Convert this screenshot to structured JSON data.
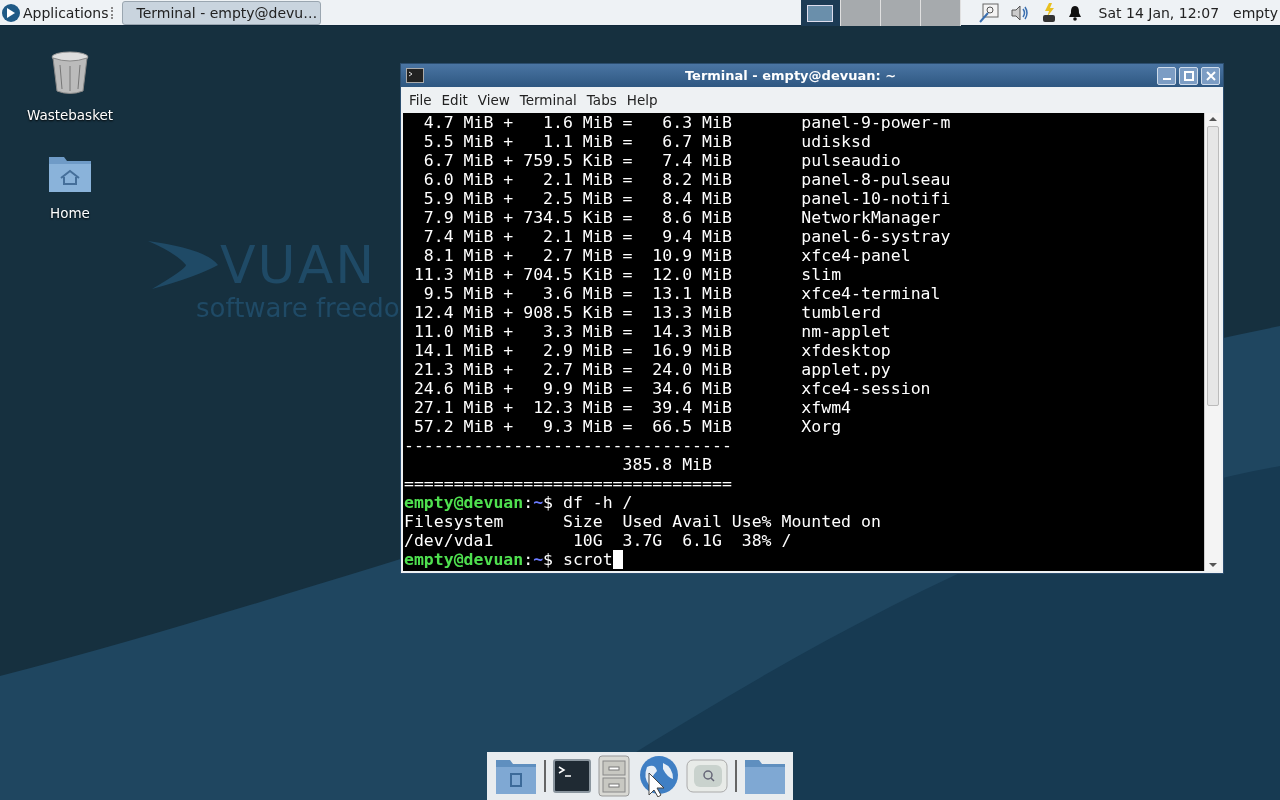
{
  "panel": {
    "apps_menu": "Applications",
    "tasks": [
      {
        "title": "Terminal - empty@devu…",
        "selected": true
      }
    ],
    "workspaces": [
      {
        "selected": true
      },
      {
        "selected": false
      },
      {
        "selected": false
      },
      {
        "selected": false
      }
    ],
    "clock": "Sat 14 Jan, 12:07",
    "user": "empty"
  },
  "desktop": {
    "icons": [
      {
        "label": "Wastebasket",
        "kind": "trash"
      },
      {
        "label": "Home",
        "kind": "home"
      }
    ],
    "logo": {
      "wordmark": "VUAN",
      "tagline": "software freedo"
    }
  },
  "terminal": {
    "title": "Terminal - empty@devuan: ~",
    "menu": [
      "File",
      "Edit",
      "View",
      "Terminal",
      "Tabs",
      "Help"
    ],
    "lines": [
      {
        "kind": "output",
        "text": "  4.7 MiB +   1.6 MiB =   6.3 MiB       panel-9-power-m"
      },
      {
        "kind": "output",
        "text": "  5.5 MiB +   1.1 MiB =   6.7 MiB       udisksd"
      },
      {
        "kind": "output",
        "text": "  6.7 MiB + 759.5 KiB =   7.4 MiB       pulseaudio"
      },
      {
        "kind": "output",
        "text": "  6.0 MiB +   2.1 MiB =   8.2 MiB       panel-8-pulseau"
      },
      {
        "kind": "output",
        "text": "  5.9 MiB +   2.5 MiB =   8.4 MiB       panel-10-notifi"
      },
      {
        "kind": "output",
        "text": "  7.9 MiB + 734.5 KiB =   8.6 MiB       NetworkManager"
      },
      {
        "kind": "output",
        "text": "  7.4 MiB +   2.1 MiB =   9.4 MiB       panel-6-systray"
      },
      {
        "kind": "output",
        "text": "  8.1 MiB +   2.7 MiB =  10.9 MiB       xfce4-panel"
      },
      {
        "kind": "output",
        "text": " 11.3 MiB + 704.5 KiB =  12.0 MiB       slim"
      },
      {
        "kind": "output",
        "text": "  9.5 MiB +   3.6 MiB =  13.1 MiB       xfce4-terminal"
      },
      {
        "kind": "output",
        "text": " 12.4 MiB + 908.5 KiB =  13.3 MiB       tumblerd"
      },
      {
        "kind": "output",
        "text": " 11.0 MiB +   3.3 MiB =  14.3 MiB       nm-applet"
      },
      {
        "kind": "output",
        "text": " 14.1 MiB +   2.9 MiB =  16.9 MiB       xfdesktop"
      },
      {
        "kind": "output",
        "text": " 21.3 MiB +   2.7 MiB =  24.0 MiB       applet.py"
      },
      {
        "kind": "output",
        "text": " 24.6 MiB +   9.9 MiB =  34.6 MiB       xfce4-session"
      },
      {
        "kind": "output",
        "text": " 27.1 MiB +  12.3 MiB =  39.4 MiB       xfwm4"
      },
      {
        "kind": "output",
        "text": " 57.2 MiB +   9.3 MiB =  66.5 MiB       Xorg"
      },
      {
        "kind": "output",
        "text": "---------------------------------"
      },
      {
        "kind": "output",
        "text": "                      385.8 MiB"
      },
      {
        "kind": "output",
        "text": "================================="
      },
      {
        "kind": "prompt",
        "user": "empty@devuan",
        "colon": ":",
        "path": "~",
        "command": "$ df -h /",
        "cursor": false
      },
      {
        "kind": "output",
        "text": "Filesystem      Size  Used Avail Use% Mounted on"
      },
      {
        "kind": "output",
        "text": "/dev/vda1        10G  3.7G  6.1G  38% /"
      },
      {
        "kind": "prompt",
        "user": "empty@devuan",
        "colon": ":",
        "path": "~",
        "command": "$ scrot",
        "cursor": true
      }
    ]
  },
  "dock": {
    "items": [
      {
        "kind": "folder-doc"
      },
      {
        "kind": "separator"
      },
      {
        "kind": "terminal"
      },
      {
        "kind": "cabinet"
      },
      {
        "kind": "globe"
      },
      {
        "kind": "search"
      },
      {
        "kind": "separator"
      },
      {
        "kind": "folder"
      }
    ]
  }
}
